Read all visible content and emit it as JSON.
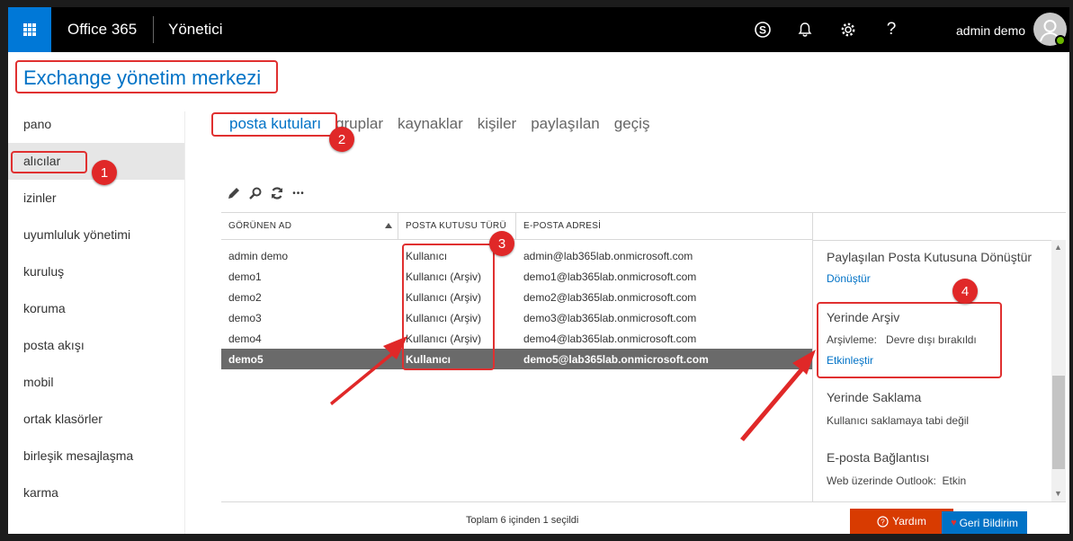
{
  "topbar": {
    "brand": "Office 365",
    "app_name": "Yönetici",
    "help_glyph": "?",
    "user_name": "admin demo",
    "icons": [
      "waffle-icon",
      "skype-icon",
      "bell-icon",
      "gear-icon",
      "help-icon",
      "avatar"
    ]
  },
  "page": {
    "title": "Exchange yönetim merkezi"
  },
  "leftnav": {
    "items": [
      "pano",
      "alıcılar",
      "izinler",
      "uyumluluk yönetimi",
      "kuruluş",
      "koruma",
      "posta akışı",
      "mobil",
      "ortak klasörler",
      "birleşik mesajlaşma",
      "karma"
    ],
    "selected": "alıcılar"
  },
  "tabs": {
    "items": [
      "posta kutuları",
      "gruplar",
      "kaynaklar",
      "kişiler",
      "paylaşılan",
      "geçiş"
    ],
    "selected": "posta kutuları"
  },
  "toolbar": {
    "icons": [
      "edit-icon",
      "search-icon",
      "refresh-icon",
      "more-icon"
    ],
    "more_glyph": "•••"
  },
  "table": {
    "headers": [
      "GÖRÜNEN AD",
      "POSTA KUTUSU TÜRÜ",
      "E-POSTA ADRESİ"
    ],
    "rows": [
      [
        "admin demo",
        "Kullanıcı",
        "admin@lab365lab.onmicrosoft.com"
      ],
      [
        "demo1",
        "Kullanıcı (Arşiv)",
        "demo1@lab365lab.onmicrosoft.com"
      ],
      [
        "demo2",
        "Kullanıcı (Arşiv)",
        "demo2@lab365lab.onmicrosoft.com"
      ],
      [
        "demo3",
        "Kullanıcı (Arşiv)",
        "demo3@lab365lab.onmicrosoft.com"
      ],
      [
        "demo4",
        "Kullanıcı (Arşiv)",
        "demo4@lab365lab.onmicrosoft.com"
      ],
      [
        "demo5",
        "Kullanıcı",
        "demo5@lab365lab.onmicrosoft.com"
      ]
    ],
    "selected_row": 5
  },
  "details": {
    "convert_title": "Paylaşılan Posta Kutusuna Dönüştür",
    "convert_link": "Dönüştür",
    "archive_title": "Yerinde Arşiv",
    "archive_label": "Arşivleme:",
    "archive_value": "Devre dışı bırakıldı",
    "archive_link": "Etkinleştir",
    "hold_title": "Yerinde Saklama",
    "hold_text": "Kullanıcı saklamaya tabi değil",
    "email_conn_title": "E-posta Bağlantısı",
    "owa_label": "Web üzerinde Outlook:",
    "owa_value": "Etkin"
  },
  "footer": {
    "status": "Toplam 6 içinden 1 seçildi",
    "help_button": "Yardım",
    "feedback_button": "Geri Bildirim"
  },
  "annotations": {
    "badges": [
      "1",
      "2",
      "3",
      "4"
    ]
  },
  "colors": {
    "accent": "#0072c6",
    "annotation": "#e03030",
    "help": "#d83b01",
    "topbar": "#000000",
    "waffle": "#0078d7"
  }
}
